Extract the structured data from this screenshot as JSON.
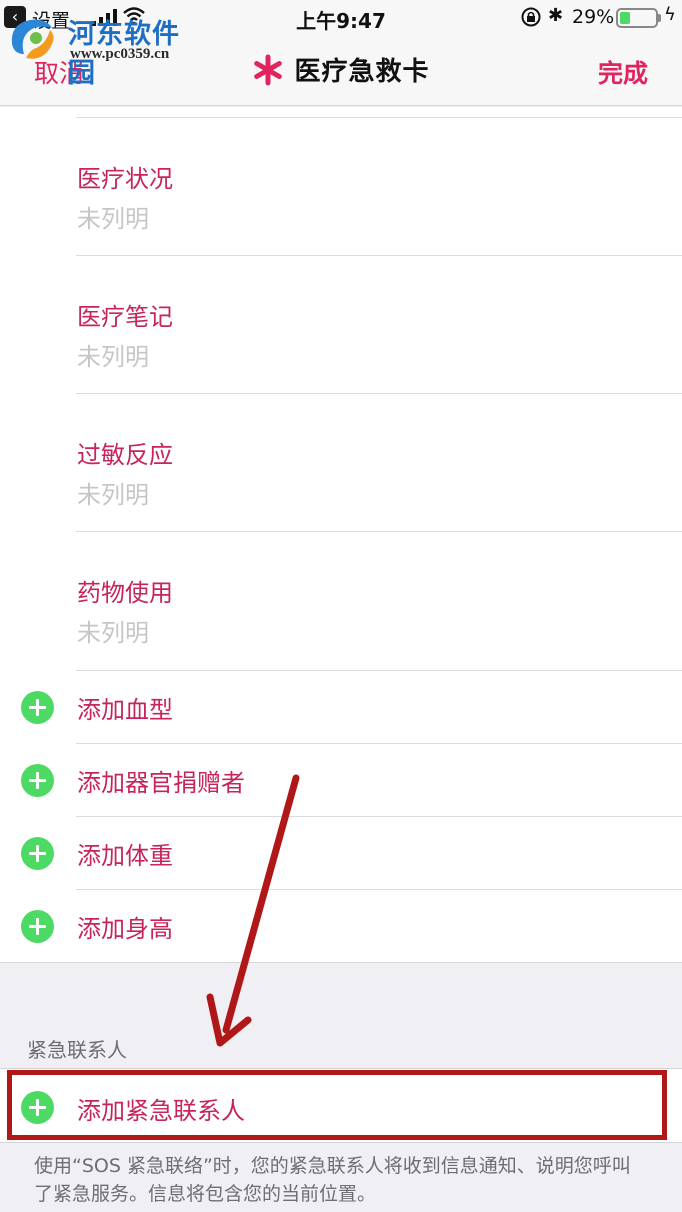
{
  "status_bar": {
    "back_app": "设置",
    "time": "上午9:47",
    "battery": "29%",
    "battery_level": 0.29
  },
  "watermark": {
    "text": "河东软件园",
    "url": "www.pc0359.cn"
  },
  "nav": {
    "cancel": "取消",
    "title": "医疗急救卡",
    "done": "完成",
    "accent_color": "#e0245e"
  },
  "fields": [
    {
      "label": "医疗状况",
      "value": "未列明"
    },
    {
      "label": "医疗笔记",
      "value": "未列明"
    },
    {
      "label": "过敏反应",
      "value": "未列明"
    },
    {
      "label": "药物使用",
      "value": "未列明"
    }
  ],
  "add_items": [
    {
      "label": "添加血型"
    },
    {
      "label": "添加器官捐赠者"
    },
    {
      "label": "添加体重"
    },
    {
      "label": "添加身高"
    }
  ],
  "emergency": {
    "section_title": "紧急联系人",
    "add_label": "添加紧急联系人",
    "note": "使用“SOS 紧急联络”时，您的紧急联系人将收到信息通知、说明您呼叫了紧急服务。信息将包含您的当前位置。"
  },
  "icons": {
    "add": "plus-circle-icon",
    "asterisk": "medical-asterisk-icon",
    "annotation_arrow": "arrow-icon"
  },
  "colors": {
    "add_green": "#4cd964",
    "label_pink": "#c7255a",
    "annotation_red": "#b01818"
  }
}
